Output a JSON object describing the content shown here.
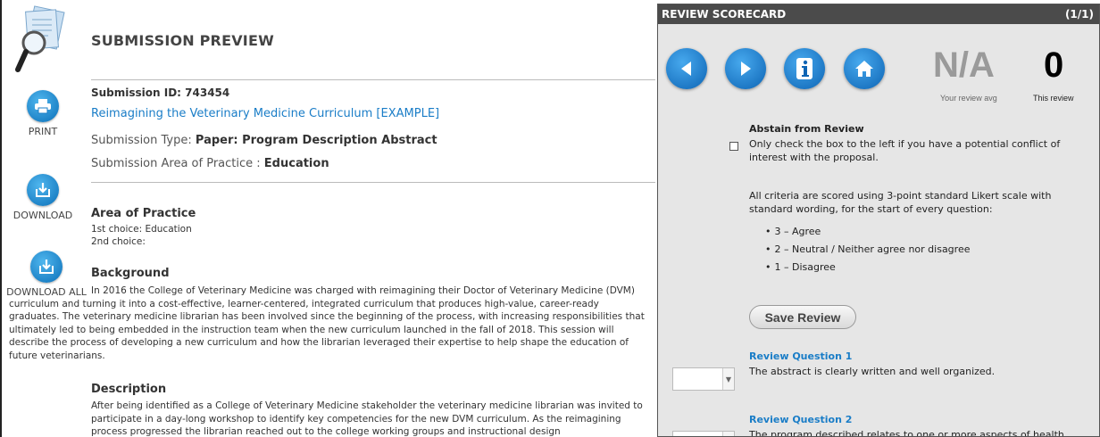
{
  "preview": {
    "title": "SUBMISSION PREVIEW",
    "submission_id": "Submission ID: 743454",
    "submission_link": "Reimagining the Veterinary Medicine Curriculum [EXAMPLE]",
    "type_label": "Submission Type:",
    "type_value": "Paper: Program Description Abstract",
    "area_label": "Submission Area of Practice :",
    "area_value": "Education",
    "area_section_title": "Area of Practice",
    "first_choice": "1st choice: Education",
    "second_choice": "2nd choice:",
    "background_title": "Background",
    "background_text": "In 2016 the College of Veterinary Medicine was charged with reimagining their Doctor of Veterinary Medicine (DVM) curriculum and turning it into a cost-effective, learner-centered, integrated curriculum that produces high-value, career-ready graduates. The veterinary medicine librarian has been involved since the beginning of the process, with increasing responsibilities that ultimately led to being embedded in the instruction team when the new curriculum launched in the fall of 2018. This session will describe the process of developing a new curriculum and how the librarian leveraged their expertise to help shape the education of future veterinarians.",
    "description_title": "Description",
    "description_text": "After being identified as a College of Veterinary Medicine stakeholder the veterinary medicine librarian was invited to participate in a day-long workshop to identify key competencies for the new DVM curriculum. As the reimagining process progressed the librarian reached out to the college working groups and instructional design"
  },
  "side_actions": {
    "print": "PRINT",
    "download": "DOWNLOAD",
    "download_all": "DOWNLOAD ALL"
  },
  "scorecard": {
    "title": "REVIEW SCORECARD",
    "counter": "(1/1)",
    "avg_value": "N/A",
    "avg_caption": "Your review avg",
    "this_value": "0",
    "this_caption": "This review",
    "abstain_title": "Abstain from Review",
    "abstain_text": "Only check the box to the left if you have a potential conflict of interest with the proposal.",
    "criteria_text": "All criteria are scored using 3-point standard Likert scale with standard wording, for the start of every question:",
    "likert": [
      "3 – Agree",
      "2 – Neutral / Neither agree nor disagree",
      "1 – Disagree"
    ],
    "save_label": "Save Review",
    "questions": [
      {
        "title": "Review Question 1",
        "text": "The abstract is clearly written and well organized."
      },
      {
        "title": "Review Question 2",
        "text": "The program described relates to one or more aspects of health"
      }
    ]
  },
  "colors": {
    "accent": "#1a7dc7",
    "header_bg": "#4b4b4b",
    "panel_bg": "#e6e6e6"
  }
}
